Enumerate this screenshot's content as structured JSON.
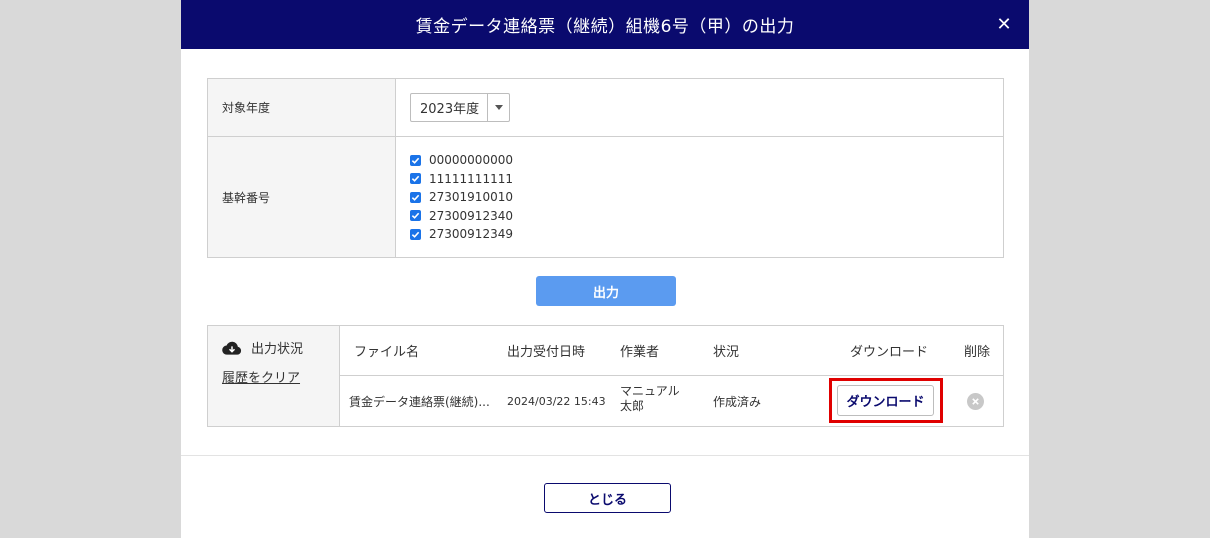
{
  "modal": {
    "title": "賃金データ連絡票（継続）組機6号（甲）の出力",
    "close_glyph": "✕"
  },
  "form": {
    "year_label": "対象年度",
    "year_value": "2023年度",
    "kikan_label": "基幹番号",
    "kikan_items": [
      {
        "value": "00000000000",
        "checked": true
      },
      {
        "value": "11111111111",
        "checked": true
      },
      {
        "value": "27301910010",
        "checked": true
      },
      {
        "value": "27300912340",
        "checked": true
      },
      {
        "value": "27300912349",
        "checked": true
      }
    ]
  },
  "actions": {
    "output_label": "出力",
    "close_label": "とじる"
  },
  "status": {
    "heading": "出力状況",
    "clear_label": "履歴をクリア",
    "columns": {
      "filename": "ファイル名",
      "received": "出力受付日時",
      "worker": "作業者",
      "state": "状況",
      "download": "ダウンロード",
      "delete": "削除"
    },
    "rows": [
      {
        "filename": "賃金データ連絡票(継続)...",
        "received": "2024/03/22 15:43",
        "worker_line1": "マニュアル",
        "worker_line2": "太郎",
        "state": "作成済み",
        "download_label": "ダウンロード"
      }
    ]
  },
  "colors": {
    "header_bg": "#0a0a6e",
    "output_button": "#5b9bf0",
    "highlight": "#e00000",
    "checkbox": "#1a73e8"
  }
}
